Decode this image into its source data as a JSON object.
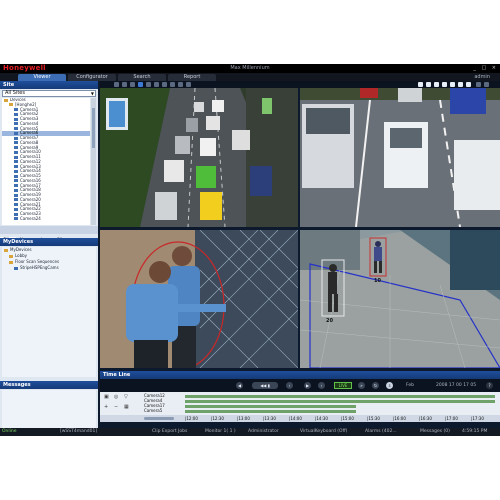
{
  "window": {
    "brand": "Honeywell",
    "title": "Max Millennium",
    "user": "admin",
    "controls": "_ □ ×"
  },
  "tabs": [
    {
      "label": "Viewer",
      "active": true
    },
    {
      "label": "Configurator",
      "active": false
    },
    {
      "label": "Search",
      "active": false
    },
    {
      "label": "Report",
      "active": false
    }
  ],
  "site_panel": {
    "header": "Site",
    "selected_site": "All Sites",
    "tree": [
      {
        "label": "Devices",
        "depth": 0
      },
      {
        "label": "[Honghe2]",
        "depth": 1
      },
      {
        "label": "Camera1",
        "depth": 2
      },
      {
        "label": "Camera2",
        "depth": 2
      },
      {
        "label": "Camera3",
        "depth": 2
      },
      {
        "label": "Camera4",
        "depth": 2
      },
      {
        "label": "Camera5",
        "depth": 2
      },
      {
        "label": "Camera6",
        "depth": 2,
        "selected": true
      },
      {
        "label": "Camera7",
        "depth": 2
      },
      {
        "label": "Camera8",
        "depth": 2
      },
      {
        "label": "Camera9",
        "depth": 2
      },
      {
        "label": "Camera10",
        "depth": 2
      },
      {
        "label": "Camera11",
        "depth": 2
      },
      {
        "label": "Camera12",
        "depth": 2
      },
      {
        "label": "Camera13",
        "depth": 2
      },
      {
        "label": "Camera14",
        "depth": 2
      },
      {
        "label": "Camera15",
        "depth": 2
      },
      {
        "label": "Camera16",
        "depth": 2
      },
      {
        "label": "Camera17",
        "depth": 2
      },
      {
        "label": "Camera18",
        "depth": 2
      },
      {
        "label": "Camera19",
        "depth": 2
      },
      {
        "label": "Camera20",
        "depth": 2
      },
      {
        "label": "Camera21",
        "depth": 2
      },
      {
        "label": "Camera22",
        "depth": 2
      },
      {
        "label": "Camera23",
        "depth": 2
      },
      {
        "label": "Camera24",
        "depth": 2
      }
    ],
    "subtabs": [
      "Site",
      "Alarms",
      "ImagerClip"
    ]
  },
  "my_devices": {
    "header": "MyDevices",
    "tree": [
      {
        "label": "MyDevices",
        "depth": 0
      },
      {
        "label": "Lobby",
        "depth": 1
      },
      {
        "label": "Floor Scan Sequences",
        "depth": 1
      },
      {
        "label": "StripeHSPEngCams",
        "depth": 2
      }
    ]
  },
  "messages": {
    "header": "Messages"
  },
  "timeline": {
    "header": "Time Line",
    "live_label": "LIVE",
    "speed": "Feb",
    "date": "2008  17  00  17  05",
    "rows": [
      "Camera12",
      "Camera4",
      "Camera17",
      "Camera5"
    ],
    "ticks": [
      "|12:00",
      "|12:30",
      "|13:00",
      "|13:30",
      "|14:00",
      "|14:30",
      "|15:00",
      "|15:30",
      "|16:00",
      "|16:30",
      "|17:00",
      "|17:30"
    ],
    "track_fill": [
      1,
      1,
      0.55,
      0.55
    ]
  },
  "status_bar": [
    "Online",
    "[wSST4mand01]",
    "Clip Export Jobs",
    "Monitor 1( 1 )",
    "Administrator",
    "VirtualKeyboard (Off)",
    "Alarms (402...",
    "Messages (0)",
    "4:59:15 PM"
  ],
  "tracking_labels": [
    "10",
    "20"
  ],
  "colors": {
    "brand": "#e21d25",
    "accent": "#3b6cb4",
    "live": "#5fc04a",
    "track": "#6fa268"
  }
}
